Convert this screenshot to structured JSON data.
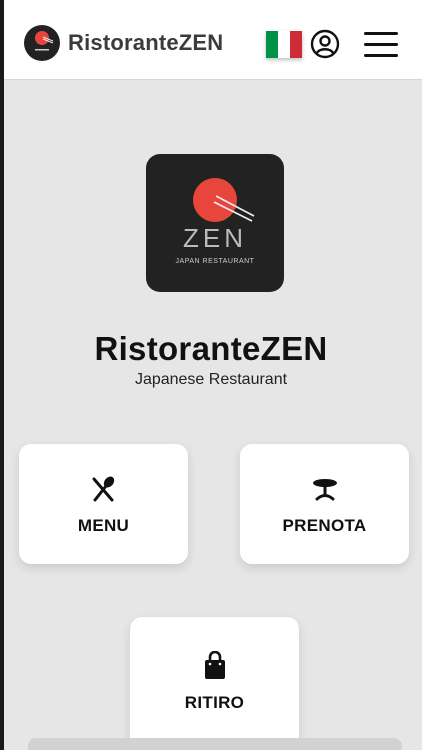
{
  "header": {
    "brand_name": "RistoranteZEN",
    "logo_icon": "zen-sun-logo-icon",
    "language_flag": "italian-flag-icon",
    "account_icon": "user-circle-icon",
    "menu_icon": "hamburger-menu-icon"
  },
  "hero": {
    "logo_text": "ZEN",
    "logo_subtext": "JAPAN RESTAURANT",
    "title": "RistoranteZEN",
    "subtitle": "Japanese Restaurant"
  },
  "actions": {
    "menu": {
      "label": "MENU",
      "icon": "fork-spoon-icon"
    },
    "prenota": {
      "label": "PRENOTA",
      "icon": "table-icon"
    },
    "ritiro": {
      "label": "RITIRO",
      "icon": "shopping-bag-icon"
    }
  },
  "colors": {
    "background": "#e6e6e6",
    "card": "#ffffff",
    "logo_bg": "#222222",
    "sun_red": "#e8453c",
    "flag_green": "#009246",
    "flag_white": "#ffffff",
    "flag_red": "#ce2b37"
  }
}
